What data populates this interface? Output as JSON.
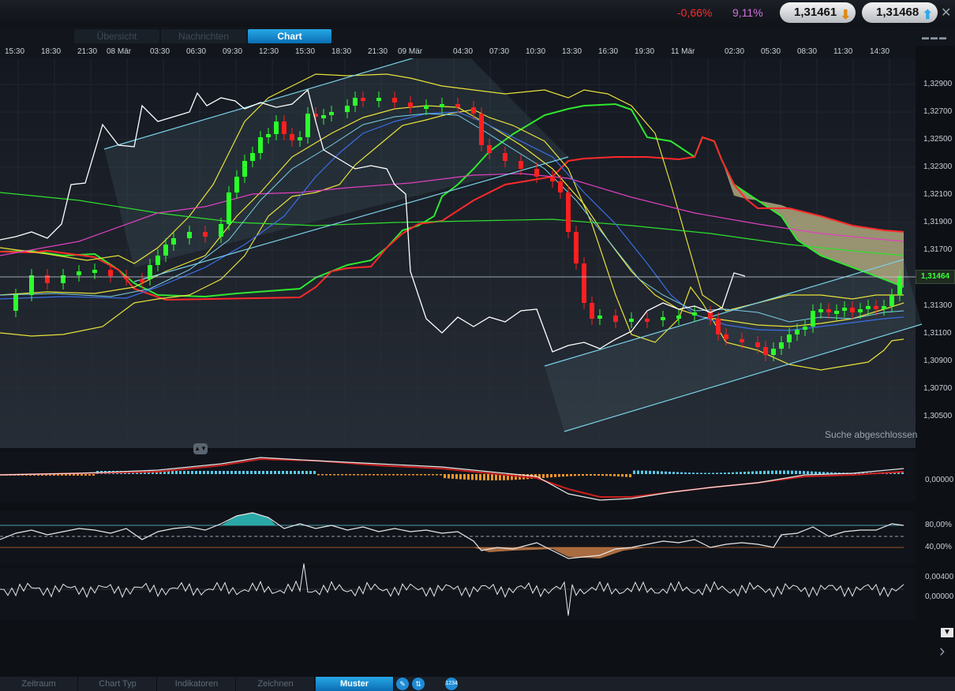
{
  "header": {
    "change_pct": "-0,66%",
    "volatility_pct": "9,11%",
    "bid": "1,31461",
    "ask": "1,31468"
  },
  "tabs": [
    "Übersicht",
    "Nachrichten",
    "Chart"
  ],
  "time_axis": [
    "15:30",
    "18:30",
    "21:30",
    "08 Mär",
    "03:30",
    "06:30",
    "09:30",
    "12:30",
    "15:30",
    "18:30",
    "21:30",
    "09 Mär",
    "04:30",
    "07:30",
    "10:30",
    "13:30",
    "16:30",
    "19:30",
    "11 Mär",
    "02:30",
    "05:30",
    "08:30",
    "11:30",
    "14:30"
  ],
  "price_axis": [
    "1,32900",
    "1,32700",
    "1,32500",
    "1,32300",
    "1,32100",
    "1,31900",
    "1,31700",
    "1,31500",
    "1,31300",
    "1,31100",
    "1,30900",
    "1,30700",
    "1,30500"
  ],
  "current_price": "1,31464",
  "status_text": "Suche abgeschlossen",
  "macd_axis": [
    "0,00000"
  ],
  "rsi_axis": [
    "80,00%",
    "40,00%"
  ],
  "mom_axis": [
    "0,00400",
    "0,00000"
  ],
  "toolbar": [
    "Zeitraum",
    "Chart Typ",
    "Indikatoren",
    "Zeichnen",
    "Muster"
  ],
  "toolbar_icons": [
    "pencil-icon",
    "swap-icon",
    "calendar-icon"
  ],
  "calendar_icon_text": "1234",
  "colors": {
    "up_candle": "#2bff2b",
    "down_candle": "#ff2020",
    "cloud": "#b8b48a",
    "bollinger": "#e8e23a",
    "close_line": "#ffffff",
    "accent": "#1a8ad6"
  }
}
